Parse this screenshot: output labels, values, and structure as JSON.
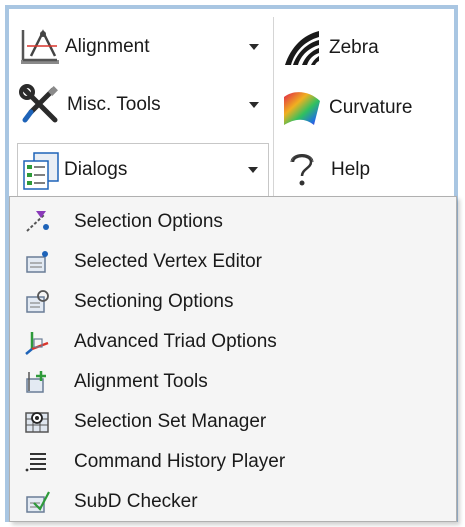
{
  "ribbon": {
    "alignment": {
      "label": "Alignment",
      "icon": "alignment-icon"
    },
    "misc_tools": {
      "label": "Misc. Tools",
      "icon": "wrench-screwdriver-icon"
    },
    "dialogs": {
      "label": "Dialogs",
      "icon": "dialogs-icon"
    },
    "zebra": {
      "label": "Zebra",
      "icon": "zebra-icon"
    },
    "curvature": {
      "label": "Curvature",
      "icon": "curvature-icon"
    },
    "help": {
      "label": "Help",
      "icon": "help-icon"
    }
  },
  "menu": {
    "items": [
      {
        "label": "Selection Options",
        "icon": "selection-options-icon"
      },
      {
        "label": "Selected Vertex Editor",
        "icon": "vertex-editor-icon"
      },
      {
        "label": "Sectioning Options",
        "icon": "sectioning-options-icon"
      },
      {
        "label": "Advanced Triad Options",
        "icon": "triad-options-icon"
      },
      {
        "label": "Alignment Tools",
        "icon": "alignment-tools-icon"
      },
      {
        "label": "Selection Set Manager",
        "icon": "selection-set-manager-icon"
      },
      {
        "label": "Command History Player",
        "icon": "command-history-icon"
      },
      {
        "label": "SubD Checker",
        "icon": "subd-checker-icon"
      }
    ]
  },
  "colors": {
    "frame_border": "#a9c6e2",
    "menu_background": "#f5f5f5",
    "accent_blue": "#1e63b8",
    "accent_green": "#2e9a3a",
    "accent_red": "#d9342b"
  }
}
